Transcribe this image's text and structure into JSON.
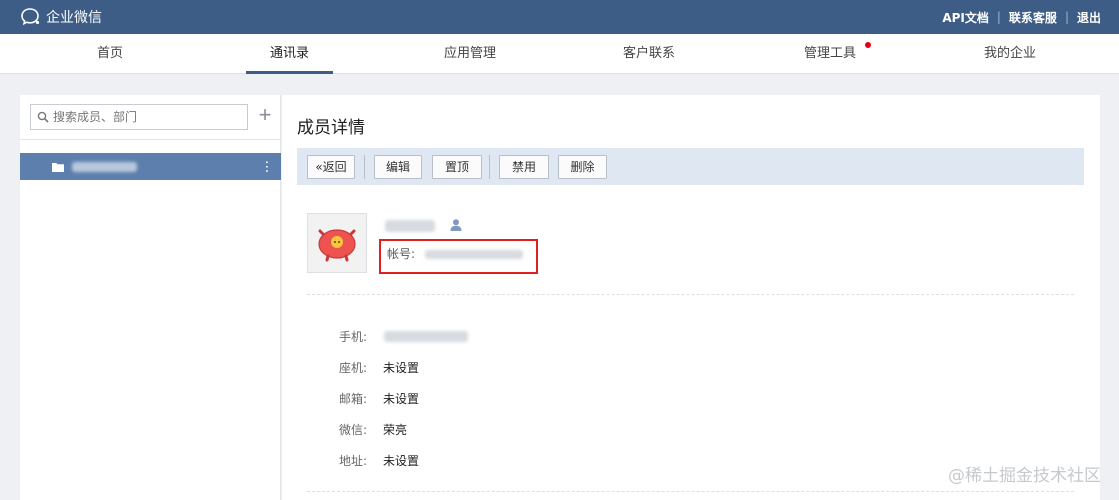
{
  "topbar": {
    "logo_text": "企业微信",
    "links": [
      "API文档",
      "联系客服",
      "退出"
    ]
  },
  "nav": {
    "items": [
      "首页",
      "通讯录",
      "应用管理",
      "客户联系",
      "管理工具",
      "我的企业"
    ],
    "active": "通讯录"
  },
  "sidebar": {
    "search_placeholder": "搜索成员、部门",
    "add_label": "+"
  },
  "main": {
    "title": "成员详情",
    "toolbar": {
      "back": "«返回",
      "edit": "编辑",
      "pin": "置顶",
      "disable": "禁用",
      "delete": "删除"
    },
    "account_label": "帐号:",
    "fields": [
      {
        "label": "手机:",
        "value": ""
      },
      {
        "label": "座机:",
        "value": "未设置"
      },
      {
        "label": "邮箱:",
        "value": "未设置"
      },
      {
        "label": "微信:",
        "value": "荣亮"
      },
      {
        "label": "地址:",
        "value": "未设置"
      }
    ]
  },
  "watermark": "@稀土掘金技术社区",
  "colors": {
    "topbar": "#3d5c86",
    "selected_row": "#5d7fad",
    "toolbar_bg": "#dfe7f3",
    "highlight": "#e02020",
    "nav_badge": "#e60012"
  }
}
